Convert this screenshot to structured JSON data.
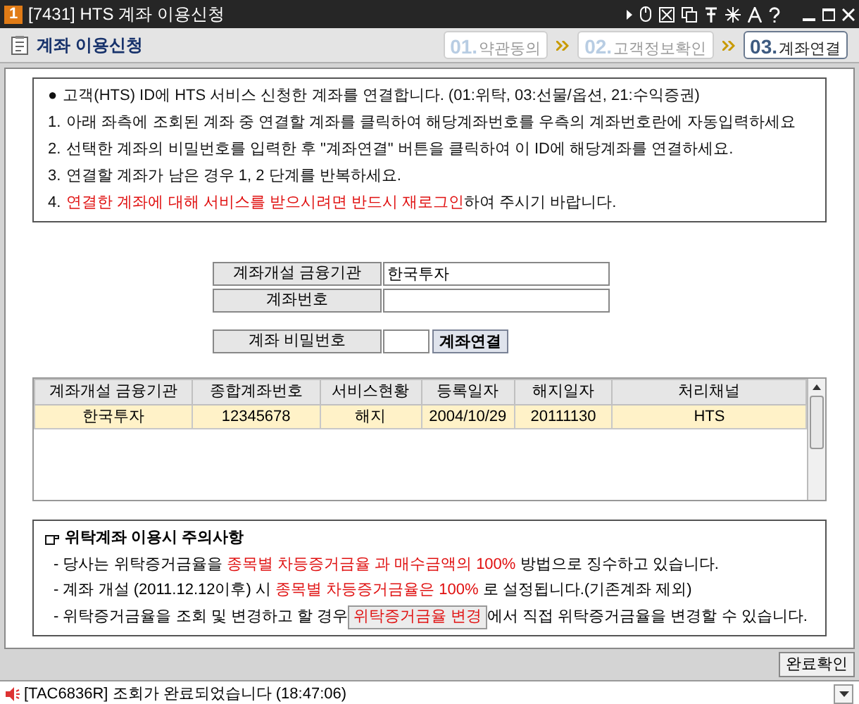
{
  "window": {
    "number": "1",
    "title": "[7431] HTS 계좌 이용신청"
  },
  "header": {
    "title": "계좌 이용신청",
    "steps": [
      {
        "number": "01.",
        "label": "약관동의",
        "selected": false
      },
      {
        "number": "02.",
        "label": "고객정보확인",
        "selected": false
      },
      {
        "number": "03.",
        "label": "계좌연결",
        "selected": true
      }
    ]
  },
  "instructions": [
    {
      "marker": "●",
      "segments": [
        {
          "text": "고객(HTS) ID에 HTS 서비스 신청한 계좌를 연결합니다. (01:위탁, 03:선물/옵션, 21:수익증권)",
          "highlight": false
        }
      ]
    },
    {
      "marker": "1.",
      "segments": [
        {
          "text": "아래  좌측에 조회된 계좌 중 연결할 계좌를 클릭하여 해당계좌번호를 우측의 계좌번호란에 자동입력하세요",
          "highlight": false
        }
      ]
    },
    {
      "marker": "2.",
      "segments": [
        {
          "text": "선택한 계좌의 비밀번호를 입력한 후 \"계좌연결\" 버튼을 클릭하여 이 ID에 해당계좌를 연결하세요.",
          "highlight": false
        }
      ]
    },
    {
      "marker": "3.",
      "segments": [
        {
          "text": "연결할 계좌가 남은 경우 1, 2 단계를 반복하세요.",
          "highlight": false
        }
      ]
    },
    {
      "marker": "4.",
      "segments": [
        {
          "text": "연결한 계좌에 대해 서비스를 받으시려면 반드시 재로그인",
          "highlight": true
        },
        {
          "text": "하여 주시기 바랍니다.",
          "highlight": false
        }
      ]
    }
  ],
  "form": {
    "institution": {
      "label": "계좌개설 금융기관",
      "value": "한국투자"
    },
    "account": {
      "label": "계좌번호"
    },
    "password": {
      "label": "계좌 비밀번호"
    },
    "connect_button": "계좌연결"
  },
  "table": {
    "columns": [
      "계좌개설 금융기관",
      "종합계좌번호",
      "서비스현황",
      "등록일자",
      "해지일자",
      "처리채널"
    ],
    "rows": [
      {
        "cells": [
          "한국투자",
          "12345678",
          "해지",
          "2004/10/29",
          "20111130",
          "HTS"
        ],
        "selected": true
      }
    ]
  },
  "notes": {
    "title": "위탁계좌 이용시 주의사항",
    "lines": [
      [
        {
          "kind": "text",
          "text": "- 당사는 위탁증거금율을 "
        },
        {
          "kind": "red",
          "text": "종목별 차등증거금율 과 매수금액의 100%"
        },
        {
          "kind": "text",
          "text": " 방법으로 징수하고 있습니다."
        }
      ],
      [
        {
          "kind": "text",
          "text": "- 계좌 개설 (2011.12.12이후) 시 "
        },
        {
          "kind": "red",
          "text": "종목별 차등증거금율은 100%"
        },
        {
          "kind": "text",
          "text": " 로 설정됩니다.(기존계좌 제외)"
        }
      ],
      [
        {
          "kind": "text",
          "text": "- 위탁증거금율을 조회 및 변경하고 할 경우 "
        },
        {
          "kind": "button",
          "text": "위탁증거금율 변경"
        },
        {
          "kind": "text",
          "text": "에서 직접 위탁증거금율을 변경할 수 있습니다."
        }
      ]
    ]
  },
  "complete_button": "완료확인",
  "status_bar": {
    "message": "[TAC6836R] 조회가 완료되었습니다 (18:47:06)"
  }
}
